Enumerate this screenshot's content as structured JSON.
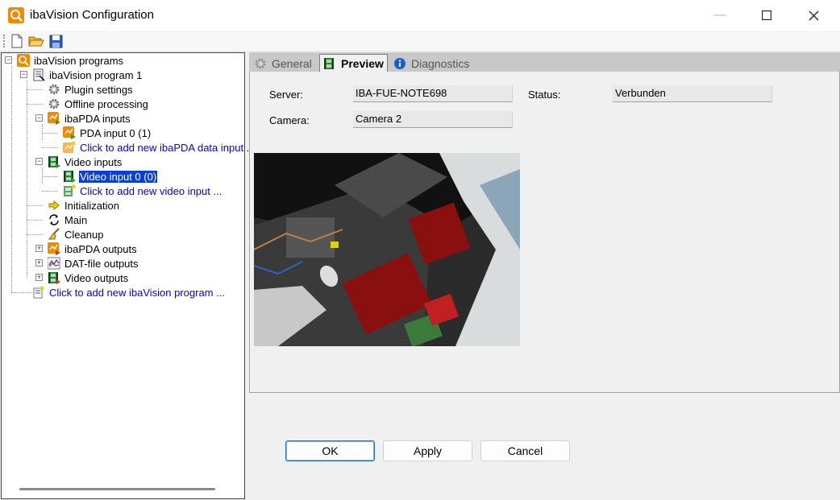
{
  "window": {
    "title": "ibaVision Configuration",
    "minimize_glyph": "—",
    "maximize_glyph": "☐",
    "close_glyph": "✕"
  },
  "toolbar": {
    "icons": [
      "new-document-icon",
      "open-folder-icon",
      "save-icon"
    ]
  },
  "tree": {
    "root": "ibaVision programs",
    "program": "ibaVision program 1",
    "plugin_settings": "Plugin settings",
    "offline_processing": "Offline processing",
    "ibapda_inputs": "ibaPDA inputs",
    "pda_input_0": "PDA input 0 (1)",
    "add_pda_input": "Click to add new ibaPDA data input ...",
    "video_inputs": "Video inputs",
    "video_input_0": "Video input 0 (0)",
    "add_video_input": "Click to add new video input ...",
    "initialization": "Initialization",
    "main": "Main",
    "cleanup": "Cleanup",
    "ibapda_outputs": "ibaPDA outputs",
    "dat_file_outputs": "DAT-file outputs",
    "video_outputs": "Video outputs",
    "add_program": "Click to add new ibaVision program ..."
  },
  "tabs": {
    "general": "General",
    "preview": "Preview",
    "diagnostics": "Diagnostics"
  },
  "preview": {
    "server_label": "Server:",
    "server_value": "IBA-FUE-NOTE698",
    "status_label": "Status:",
    "status_value": "Verbunden",
    "camera_label": "Camera:",
    "camera_value": "Camera 2"
  },
  "buttons": {
    "ok": "OK",
    "apply": "Apply",
    "cancel": "Cancel"
  },
  "colors": {
    "selection": "#0a3fd8",
    "link": "#0000ee",
    "accent_orange": "#f28a00"
  }
}
